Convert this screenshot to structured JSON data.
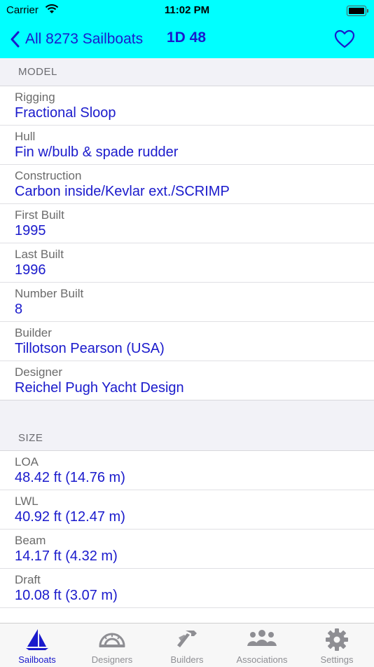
{
  "status_bar": {
    "carrier": "Carrier",
    "time": "11:02 PM"
  },
  "nav": {
    "back_label": "All 8273 Sailboats",
    "title": "1D 48"
  },
  "model": {
    "header": "MODEL",
    "rows": [
      {
        "label": "Rigging",
        "value": "Fractional  Sloop"
      },
      {
        "label": "Hull",
        "value": "Fin w/bulb & spade rudder"
      },
      {
        "label": "Construction",
        "value": "Carbon inside/Kevlar ext./SCRIMP"
      },
      {
        "label": "First Built",
        "value": "1995"
      },
      {
        "label": "Last Built",
        "value": "1996"
      },
      {
        "label": "Number Built",
        "value": "8"
      },
      {
        "label": "Builder",
        "value": "Tillotson Pearson (USA)"
      },
      {
        "label": "Designer",
        "value": "Reichel Pugh Yacht Design"
      }
    ]
  },
  "size": {
    "header": "SIZE",
    "rows": [
      {
        "label": "LOA",
        "value": "48.42 ft  (14.76 m)"
      },
      {
        "label": "LWL",
        "value": "40.92 ft  (12.47 m)"
      },
      {
        "label": "Beam",
        "value": "14.17 ft  (4.32 m)"
      },
      {
        "label": "Draft",
        "value": "10.08 ft  (3.07 m)"
      }
    ]
  },
  "tabs": [
    {
      "label": "Sailboats",
      "icon": "sailboat-icon",
      "active": true
    },
    {
      "label": "Designers",
      "icon": "protractor-icon"
    },
    {
      "label": "Builders",
      "icon": "hammer-icon"
    },
    {
      "label": "Associations",
      "icon": "people-icon"
    },
    {
      "label": "Settings",
      "icon": "gear-icon"
    }
  ],
  "colors": {
    "nav_bg": "#00ffff",
    "accent": "#1a1acc"
  }
}
